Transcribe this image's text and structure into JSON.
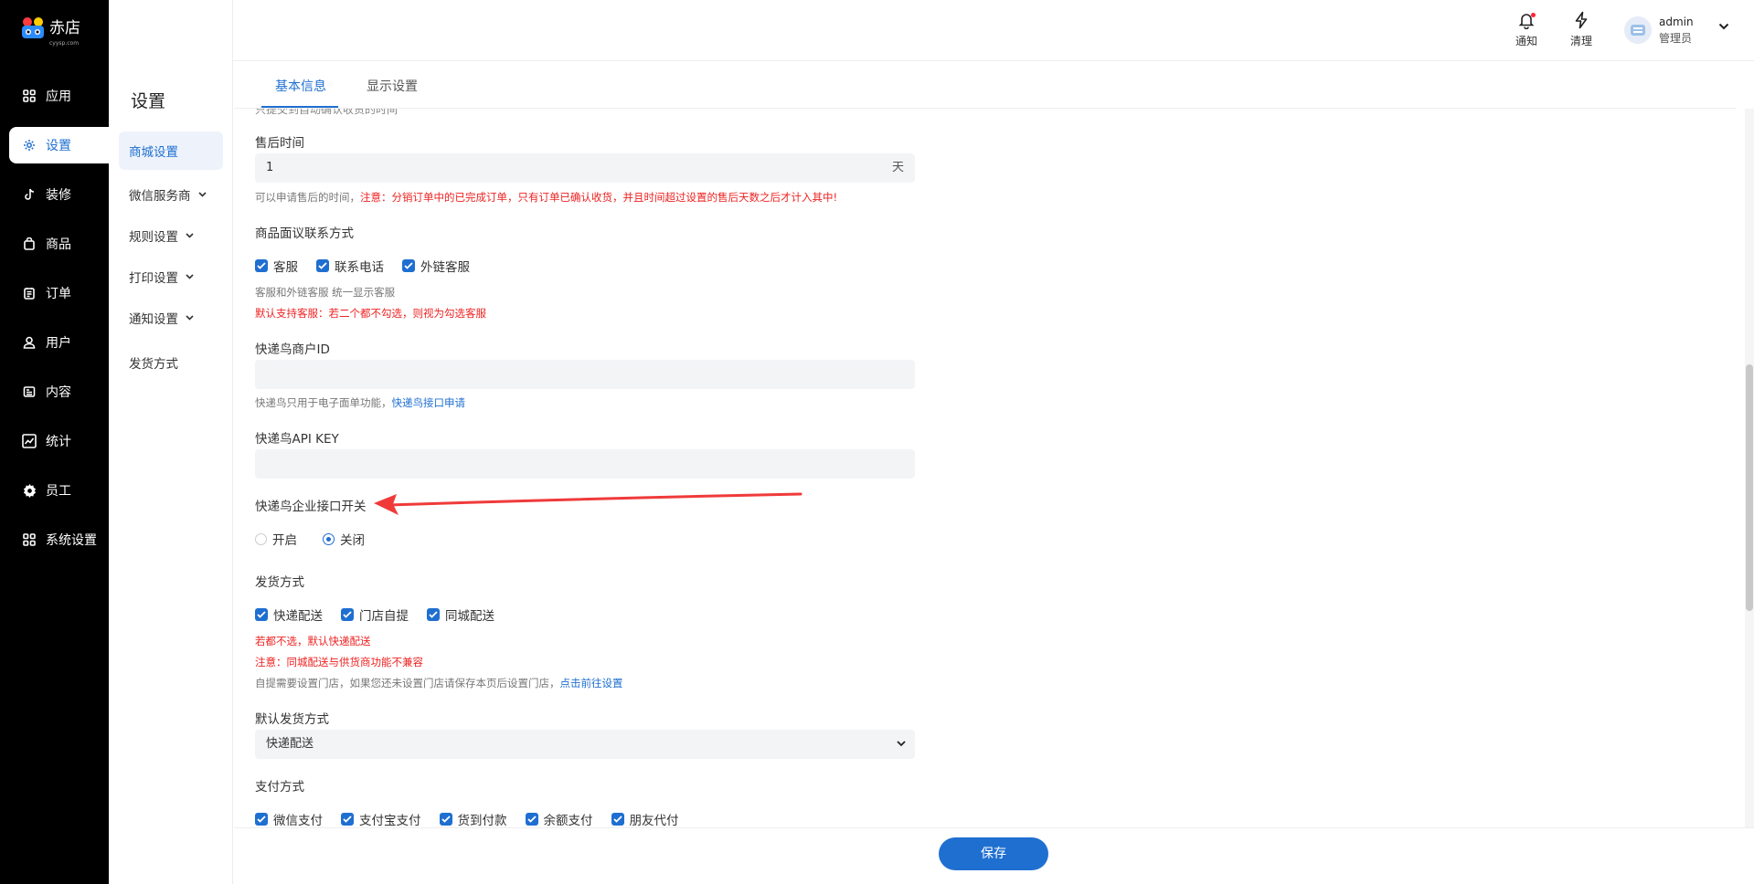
{
  "brand": {
    "name": "赤店",
    "sub": "cyysp.com"
  },
  "nav": [
    {
      "label": "应用",
      "icon": "apps-icon"
    },
    {
      "label": "设置",
      "icon": "gear-icon"
    },
    {
      "label": "装修",
      "icon": "tiktok-icon"
    },
    {
      "label": "商品",
      "icon": "goods-icon"
    },
    {
      "label": "订单",
      "icon": "order-icon"
    },
    {
      "label": "用户",
      "icon": "user-icon"
    },
    {
      "label": "内容",
      "icon": "content-icon"
    },
    {
      "label": "统计",
      "icon": "chart-icon"
    },
    {
      "label": "员工",
      "icon": "staff-gear-icon"
    },
    {
      "label": "系统设置",
      "icon": "apps-icon"
    }
  ],
  "subnav": {
    "title": "设置",
    "items": [
      "商城设置",
      "微信服务商",
      "规则设置",
      "打印设置",
      "通知设置",
      "发货方式"
    ]
  },
  "header": {
    "notify": "通知",
    "clear": "清理",
    "user_name": "admin",
    "user_role": "管理员"
  },
  "tabs": [
    "基本信息",
    "显示设置"
  ],
  "form": {
    "clipped_help": "只提交到自动确认收货的时间",
    "after_sale": {
      "label": "售后时间",
      "value": "1",
      "suffix": "天",
      "help": "可以申请售后的时间，",
      "warn": "注意：分销订单中的已完成订单，只有订单已确认收货，并且时间超过设置的售后天数之后才计入其中!"
    },
    "contact": {
      "label": "商品面议联系方式",
      "options": [
        "客服",
        "联系电话",
        "外链客服"
      ],
      "help": "客服和外链客服 统一显示客服",
      "warn": "默认支持客服：若二个都不勾选，则视为勾选客服"
    },
    "kdn_id": {
      "label": "快递鸟商户ID",
      "value": "",
      "help": "快递鸟只用于电子面单功能，",
      "link": "快递鸟接口申请"
    },
    "kdn_key": {
      "label": "快递鸟API KEY",
      "value": ""
    },
    "kdn_switch": {
      "label": "快递鸟企业接口开关",
      "on": "开启",
      "off": "关闭",
      "selected": "关闭"
    },
    "delivery": {
      "label": "发货方式",
      "options": [
        "快递配送",
        "门店自提",
        "同城配送"
      ],
      "warn1": "若都不选，默认快递配送",
      "warn2": "注意：同城配送与供货商功能不兼容",
      "help": "自提需要设置门店，如果您还未设置门店请保存本页后设置门店，",
      "link": "点击前往设置"
    },
    "default_delivery": {
      "label": "默认发货方式",
      "value": "快递配送"
    },
    "payment": {
      "label": "支付方式",
      "options": [
        "微信支付",
        "支付宝支付",
        "货到付款",
        "余额支付",
        "朋友代付"
      ]
    }
  },
  "footer": {
    "save": "保存"
  },
  "colors": {
    "accent": "#1f6fd1",
    "warn": "#ee2222",
    "sidebar": "#000000",
    "arrow": "#f03a3a"
  }
}
